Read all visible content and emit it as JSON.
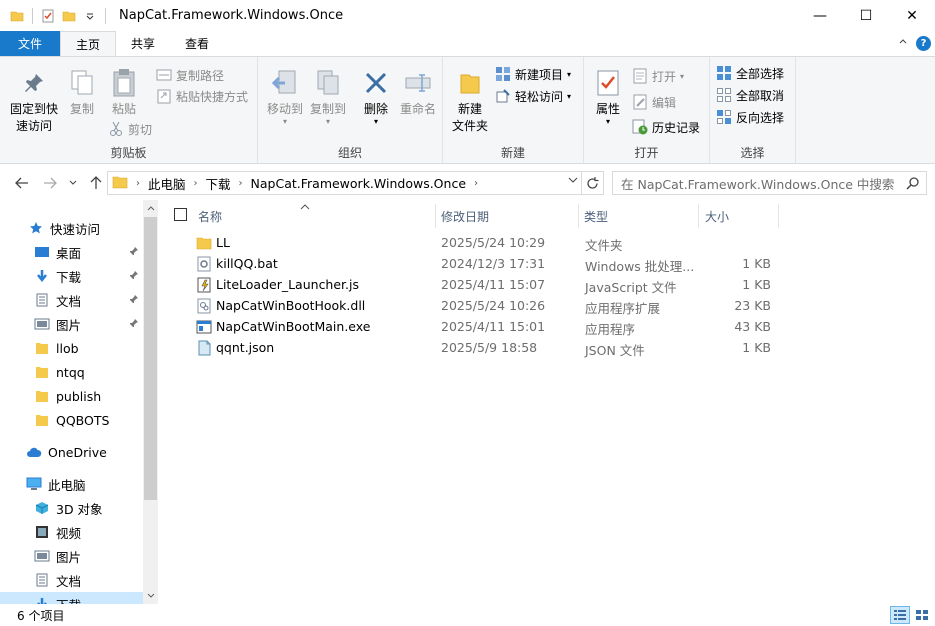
{
  "window": {
    "title": "NapCat.Framework.Windows.Once",
    "minimize": "—",
    "maximize": "☐",
    "close": "✕"
  },
  "tabs": {
    "file": "文件",
    "home": "主页",
    "share": "共享",
    "view": "查看"
  },
  "ribbon": {
    "clipboard": {
      "label": "剪贴板",
      "pin": [
        "固定到快",
        "速访问"
      ],
      "copy": "复制",
      "paste": "粘贴",
      "copy_path": "复制路径",
      "paste_shortcut": "粘贴快捷方式",
      "cut": "剪切"
    },
    "organize": {
      "label": "组织",
      "move_to": "移动到",
      "copy_to": "复制到",
      "delete": "删除",
      "rename": "重命名"
    },
    "new": {
      "label": "新建",
      "new_folder": [
        "新建",
        "文件夹"
      ],
      "new_item": "新建项目",
      "easy_access": "轻松访问"
    },
    "open": {
      "label": "打开",
      "properties": "属性",
      "open": "打开",
      "edit": "编辑",
      "history": "历史记录"
    },
    "select": {
      "label": "选择",
      "select_all": "全部选择",
      "select_none": "全部取消",
      "invert": "反向选择"
    }
  },
  "address": {
    "crumbs": [
      "此电脑",
      "下载",
      "NapCat.Framework.Windows.Once"
    ],
    "search_placeholder": "在 NapCat.Framework.Windows.Once 中搜索"
  },
  "nav": {
    "quick_access": "快速访问",
    "items": [
      {
        "label": "桌面",
        "pinned": true
      },
      {
        "label": "下载",
        "pinned": true
      },
      {
        "label": "文档",
        "pinned": true
      },
      {
        "label": "图片",
        "pinned": true
      },
      {
        "label": "llob",
        "pinned": false
      },
      {
        "label": "ntqq",
        "pinned": false
      },
      {
        "label": "publish",
        "pinned": false
      },
      {
        "label": "QQBOTS",
        "pinned": false
      }
    ],
    "onedrive": "OneDrive",
    "this_pc": "此电脑",
    "pc_items": [
      "3D 对象",
      "视频",
      "图片",
      "文档",
      "下载"
    ]
  },
  "columns": {
    "name": "名称",
    "date": "修改日期",
    "type": "类型",
    "size": "大小"
  },
  "files": [
    {
      "name": "LL",
      "date": "2025/5/24 10:29",
      "type": "文件夹",
      "size": "",
      "icon": "folder-icon"
    },
    {
      "name": "killQQ.bat",
      "date": "2024/12/3 17:31",
      "type": "Windows 批处理...",
      "size": "1 KB",
      "icon": "bat-file-icon"
    },
    {
      "name": "LiteLoader_Launcher.js",
      "date": "2025/4/11 15:07",
      "type": "JavaScript 文件",
      "size": "1 KB",
      "icon": "js-file-icon"
    },
    {
      "name": "NapCatWinBootHook.dll",
      "date": "2025/5/24 10:26",
      "type": "应用程序扩展",
      "size": "23 KB",
      "icon": "dll-file-icon"
    },
    {
      "name": "NapCatWinBootMain.exe",
      "date": "2025/4/11 15:01",
      "type": "应用程序",
      "size": "43 KB",
      "icon": "exe-file-icon"
    },
    {
      "name": "qqnt.json",
      "date": "2025/5/9 18:58",
      "type": "JSON 文件",
      "size": "1 KB",
      "icon": "json-file-icon"
    }
  ],
  "status": {
    "count": "6 个项目"
  },
  "colors": {
    "accent": "#1979ca",
    "folder": "#f5c94c",
    "selection": "#cce8ff"
  }
}
